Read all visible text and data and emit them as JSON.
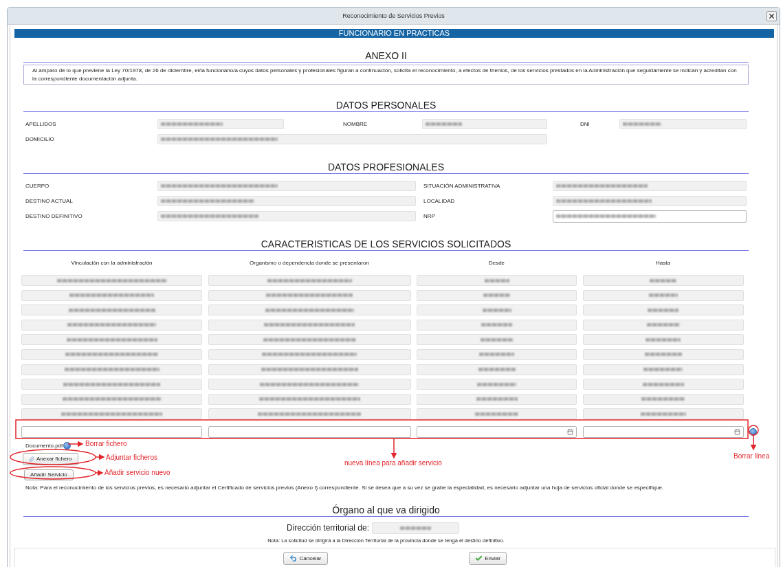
{
  "window": {
    "title": "Reconocimiento de Servicios Previos"
  },
  "banner": "FUNCIONARIO EN PRACTICAS",
  "annex": {
    "title": "ANEXO II",
    "text": "Al amparo de lo que previene la Ley 70/1978, de 26 de diciembre, el/la funcionario/a cuyos datos personales y profesionales figuran a continuación, solicita el reconocimiento, a efectos de trienios, de los servicios prestados en la Administración que seguidamente se indican y acreditan con la correspondiente documentación adjunta."
  },
  "personal": {
    "title": "DATOS PERSONALES",
    "fields": [
      {
        "label": "APELLIDOS",
        "editable": false,
        "wide": false
      },
      {
        "label": "NOMBRE",
        "editable": false,
        "wide": false
      },
      {
        "label": "DNI",
        "editable": false,
        "wide": false
      },
      {
        "label": "DOMICILIO",
        "editable": false,
        "wide": true
      }
    ]
  },
  "professional": {
    "title": "DATOS PROFESIONALES",
    "fields": [
      {
        "label": "CUERPO",
        "editable": false
      },
      {
        "label": "SITUACIÓN ADMINISTRATIVA",
        "editable": false
      },
      {
        "label": "DESTINO ACTUAL",
        "editable": false
      },
      {
        "label": "LOCALIDAD",
        "editable": false
      },
      {
        "label": "DESTINO DEFINITIVO",
        "editable": false
      },
      {
        "label": "NRP",
        "editable": true
      }
    ]
  },
  "services": {
    "title": "CARACTERISTICAS DE LOS SERVICIOS SOLICITADOS",
    "columns": [
      "Vinculación con la administración",
      "Organismo o dependencia donde se presentaron",
      "Desde",
      "Hasta"
    ],
    "rows": [
      {
        "kind": "filled"
      },
      {
        "kind": "filled"
      },
      {
        "kind": "filled"
      },
      {
        "kind": "filled"
      },
      {
        "kind": "filled"
      },
      {
        "kind": "filled"
      },
      {
        "kind": "filled"
      },
      {
        "kind": "filled"
      },
      {
        "kind": "filled"
      },
      {
        "kind": "filled"
      },
      {
        "kind": "new"
      }
    ]
  },
  "attachment": {
    "file": "Documento.pdf",
    "attach_button": "Anexar fichero",
    "add_button": "Añadir Servicio"
  },
  "note": "Nota: Para el reconocimiento de los servicios previos, es necesario adjuntar el Certificado de servicios previos (Anexo I) correspondiente. Si se desea que a su vez se grabe la especialidad, es necesario adjuntar una hoja de servicios oficial donde se especifique.",
  "destination": {
    "title": "Órgano al que va dirigido",
    "label": "Dirección territorial de:",
    "note": "Nota: La solicitud se dirigirá a la Dirección Territorial de la provincia donde se tenga el destino definitivo."
  },
  "footer": {
    "cancel": "Cancelar",
    "send": "Enviar"
  },
  "annotations": [
    {
      "text": "Borrar fichero"
    },
    {
      "text": "Adjuntar ficheros"
    },
    {
      "text": "Añadir servicio nuevo"
    },
    {
      "text": "nueva línea para añadir servicio"
    },
    {
      "text": "Borrar línea"
    }
  ]
}
